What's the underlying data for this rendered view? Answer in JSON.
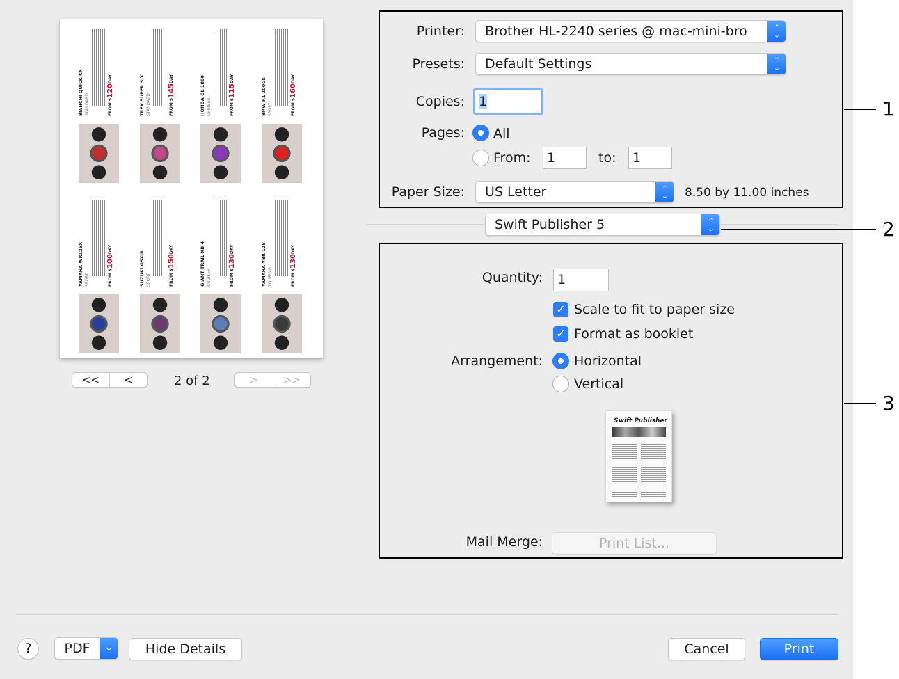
{
  "preview": {
    "cards": [
      {
        "title": "BIANCHI QUICK CX",
        "category": "STANDARD",
        "price_prefix": "FROM $",
        "price": "120",
        "price_suffix": "DAY",
        "photo_color": "#c0302e"
      },
      {
        "title": "TREK SUPER SIX",
        "category": "STANDARD",
        "price_prefix": "FROM $",
        "price": "145",
        "price_suffix": "DAY",
        "photo_color": "#c04a8a"
      },
      {
        "title": "HONDA GL 1800",
        "category": "CRUISER",
        "price_prefix": "FROM $",
        "price": "115",
        "price_suffix": "DAY",
        "photo_color": "#8a3ab8"
      },
      {
        "title": "BMW R1 200GS",
        "category": "SPORT",
        "price_prefix": "FROM $",
        "price": "160",
        "price_suffix": "DAY",
        "photo_color": "#e02020"
      },
      {
        "title": "YAMAHA WR125X",
        "category": "SPORT",
        "price_prefix": "FROM $",
        "price": "100",
        "price_suffix": "DAY",
        "photo_color": "#2a3f9a"
      },
      {
        "title": "SUZUKI GSX-R",
        "category": "SPORT",
        "price_prefix": "FROM $",
        "price": "150",
        "price_suffix": "DAY",
        "photo_color": "#6a3a70"
      },
      {
        "title": "GIANT TRAIL XB 4",
        "category": "CRUISER",
        "price_prefix": "FROM $",
        "price": "130",
        "price_suffix": "DAY",
        "photo_color": "#5a7fb8"
      },
      {
        "title": "YAMAHA YBR 125",
        "category": "TOURING",
        "price_prefix": "FROM $",
        "price": "130",
        "price_suffix": "DAY",
        "photo_color": "#3a3a3a"
      }
    ],
    "page_indicator": "2 of 2",
    "first_label": "<<",
    "prev_label": "<",
    "next_label": ">",
    "last_label": ">>"
  },
  "printer": {
    "label": "Printer:",
    "value": "Brother HL-2240 series @ mac-mini-bro"
  },
  "presets": {
    "label": "Presets:",
    "value": "Default Settings"
  },
  "copies": {
    "label": "Copies:",
    "value": "1"
  },
  "pages": {
    "label": "Pages:",
    "all_label": "All",
    "all_selected": true,
    "from_label": "From:",
    "from_value": "1",
    "to_label": "to:",
    "to_value": "1"
  },
  "paper_size": {
    "label": "Paper Size:",
    "value": "US Letter",
    "dimensions": "8.50 by 11.00 inches"
  },
  "section_popup": {
    "value": "Swift Publisher 5"
  },
  "app_options": {
    "quantity_label": "Quantity:",
    "quantity_value": "1",
    "scale_label": "Scale to fit to paper size",
    "scale_checked": true,
    "booklet_label": "Format as booklet",
    "booklet_checked": true,
    "arrangement_label": "Arrangement:",
    "horizontal_label": "Horizontal",
    "horizontal_selected": true,
    "vertical_label": "Vertical",
    "booklet_preview_title": "Swift Publisher",
    "mail_merge_label": "Mail Merge:",
    "print_list_label": "Print List..."
  },
  "footer": {
    "help_label": "?",
    "pdf_label": "PDF",
    "hide_details_label": "Hide Details",
    "cancel_label": "Cancel",
    "print_label": "Print"
  },
  "callouts": [
    "1",
    "2",
    "3"
  ],
  "colors": {
    "accent": "#2e7cf6",
    "background": "#ececec",
    "price": "#c8102e"
  }
}
